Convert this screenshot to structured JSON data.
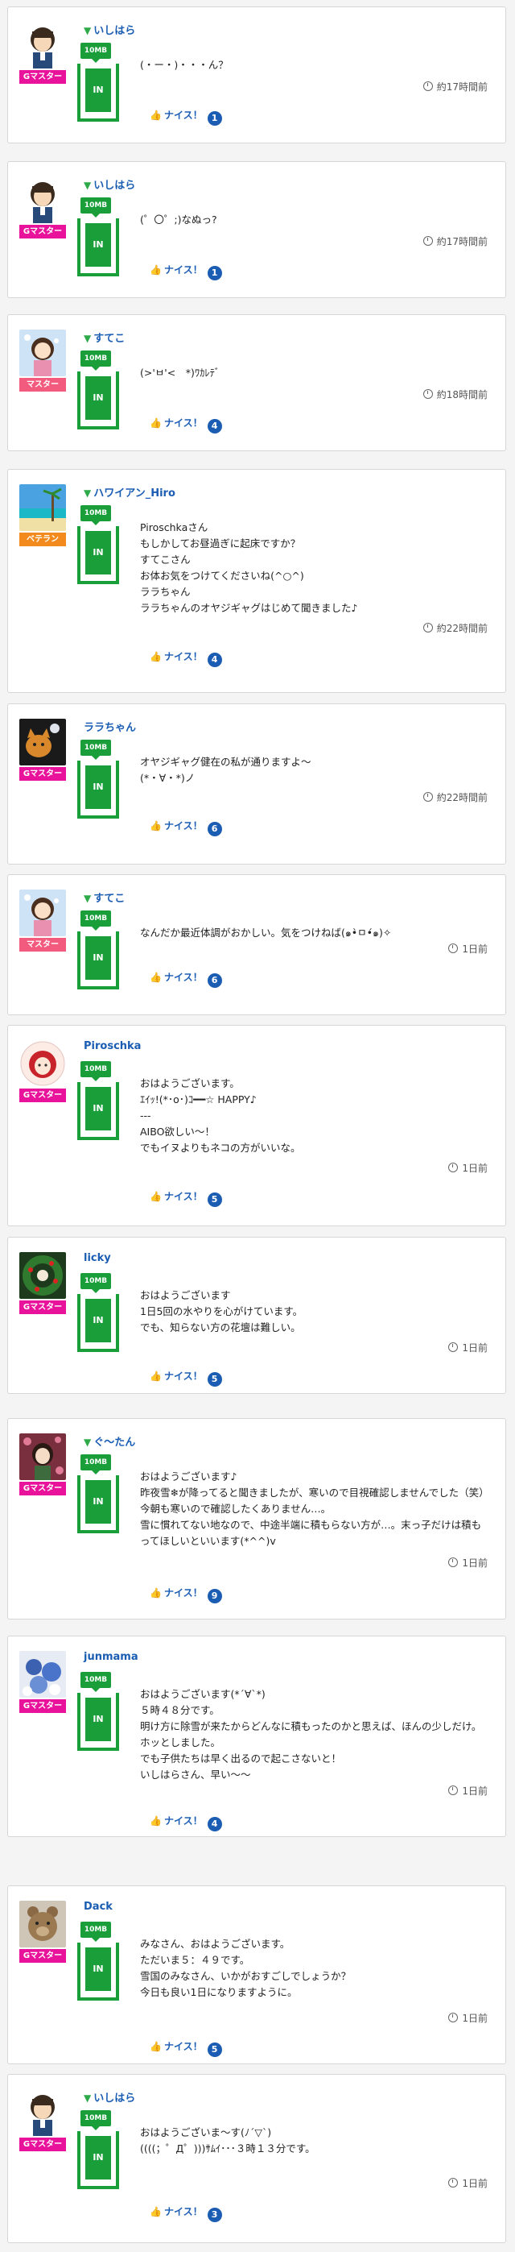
{
  "posts": [
    {
      "user": "いしはら",
      "leaf": true,
      "rank": "Gマスター",
      "mb": "10MB",
      "in": "IN",
      "message": "(・ー・)・・・ん？",
      "time": "約17時間前",
      "nice_label": "ナイス！",
      "nice_count": "1",
      "avatar": "boy",
      "rank_style": "gm"
    },
    {
      "user": "いしはら",
      "leaf": true,
      "rank": "Gマスター",
      "mb": "10MB",
      "in": "IN",
      "message": "(゜〇゜;)なぬっ?",
      "time": "約17時間前",
      "nice_label": "ナイス！",
      "nice_count": "1",
      "avatar": "boy",
      "rank_style": "gm"
    },
    {
      "user": "すてこ",
      "leaf": true,
      "rank": "マスター",
      "mb": "10MB",
      "in": "IN",
      "message": "(>'ㅂ'<　*)ﾜｶﾚﾃﾞ",
      "time": "約18時間前",
      "nice_label": "ナイス！",
      "nice_count": "4",
      "avatar": "girl",
      "rank_style": "ms"
    },
    {
      "user": "ハワイアン_Hiro",
      "leaf": true,
      "rank": "ベテラン",
      "mb": "10MB",
      "in": "IN",
      "message": "Piroschkaさん\nもしかしてお昼過ぎに起床ですか？\nすてこさん\nお体お気をつけてくださいね(^○^)\nララちゃん\nララちゃんのオヤジギャグはじめて聞きました♪",
      "time": "約22時間前",
      "nice_label": "ナイス！",
      "nice_count": "4",
      "avatar": "beach",
      "rank_style": "vt"
    },
    {
      "user": "ララちゃん",
      "leaf": false,
      "rank": "Gマスター",
      "mb": "10MB",
      "in": "IN",
      "message": "オヤジギャグ健在の私が通りますよ〜\n(*・∀・*)ノ",
      "time": "約22時間前",
      "nice_label": "ナイス！",
      "nice_count": "6",
      "avatar": "cat",
      "rank_style": "gm"
    },
    {
      "user": "すてこ",
      "leaf": true,
      "rank": "マスター",
      "mb": "10MB",
      "in": "IN",
      "message": "なんだか最近体調がおかしい。気をつけねば(๑•̀ㅁ•́๑)✧",
      "time": "1日前",
      "nice_label": "ナイス！",
      "nice_count": "6",
      "avatar": "girl",
      "rank_style": "ms"
    },
    {
      "user": "Piroschka",
      "leaf": false,
      "rank": "Gマスター",
      "mb": "10MB",
      "in": "IN",
      "message": "おはようございます。\nｴｲｯ!(*･o･)ｺ━━☆ HAPPY♪\n---\nAIBO欲しい〜！\nでもイヌよりもネコの方がいいな。",
      "time": "1日前",
      "nice_label": "ナイス！",
      "nice_count": "5",
      "avatar": "doll",
      "rank_style": "gm"
    },
    {
      "user": "licky",
      "leaf": false,
      "rank": "Gマスター",
      "mb": "10MB",
      "in": "IN",
      "message": "おはようございます\n1日5回の水やりを心がけています。\nでも、知らない方の花壇は難しい。",
      "time": "1日前",
      "nice_label": "ナイス！",
      "nice_count": "5",
      "avatar": "wreath",
      "rank_style": "gm"
    },
    {
      "user": "ぐ〜たん",
      "leaf": true,
      "rank": "Gマスター",
      "mb": "10MB",
      "in": "IN",
      "message": "おはようございます♪\n昨夜雪❄が降ってると聞きましたが、寒いので目視確認しませんでした（笑）今朝も寒いので確認したくありません…。\n雪に慣れてない地なので、中途半端に積もらない方が…。末っ子だけは積もってほしいといいます(*^^)v",
      "time": "1日前",
      "nice_label": "ナイス！",
      "nice_count": "9",
      "avatar": "anime",
      "rank_style": "gm"
    },
    {
      "user": "junmama",
      "leaf": false,
      "rank": "Gマスター",
      "mb": "10MB",
      "in": "IN",
      "message": "おはようございます(*´∀`*)\n５時４８分です。\n明け方に除雪が来たからどんなに積もったのかと思えば、ほんの少しだけ。\nホッとしました。\nでも子供たちは早く出るので起こさないと！\nいしはらさん、早い〜〜",
      "time": "1日前",
      "nice_label": "ナイス！",
      "nice_count": "4",
      "avatar": "flowers",
      "rank_style": "gm"
    },
    {
      "user": "Dack",
      "leaf": false,
      "rank": "Gマスター",
      "mb": "10MB",
      "in": "IN",
      "message": "みなさん、おはようございます。\nただいま５：４９です。\n雪国のみなさん、いかがおすごしでしょうか？\n今日も良い1日になりますように。",
      "time": "1日前",
      "nice_label": "ナイス！",
      "nice_count": "5",
      "avatar": "bear",
      "rank_style": "gm"
    },
    {
      "user": "いしはら",
      "leaf": true,
      "rank": "Gマスター",
      "mb": "10MB",
      "in": "IN",
      "message": "おはようございま〜す(ﾉ´▽`)\n((((；゜Д゜)))ｻﾑｲ･･･３時１３分です。",
      "time": "1日前",
      "nice_label": "ナイス！",
      "nice_count": "3",
      "avatar": "boy",
      "rank_style": "gm"
    }
  ],
  "colors": {
    "green": "#1a9e3a",
    "link": "#1a5db3",
    "gmaster": "#e8129b",
    "master": "#f35b7e",
    "veteran": "#f28a1e"
  },
  "icons": {
    "leaf": "beginner-leaf-icon",
    "clock": "clock-icon",
    "thumb": "thumbs-up-icon"
  }
}
